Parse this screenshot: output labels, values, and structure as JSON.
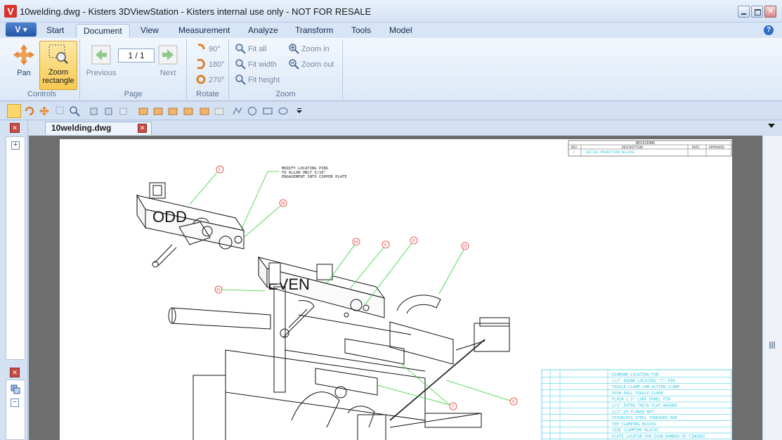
{
  "window": {
    "app_logo": "V",
    "title": "10welding.dwg - Kisters 3DViewStation - Kisters internal use only - NOT FOR RESALE"
  },
  "menu": {
    "app_button": "V",
    "tabs": [
      "Start",
      "Document",
      "View",
      "Measurement",
      "Analyze",
      "Transform",
      "Tools",
      "Model"
    ],
    "active_tab": "Document",
    "help": "?"
  },
  "ribbon": {
    "controls": {
      "label": "Controls",
      "pan": "Pan",
      "zoom_rect_line1": "Zoom",
      "zoom_rect_line2": "rectangle"
    },
    "page": {
      "label": "Page",
      "previous": "Previous",
      "next": "Next",
      "current": "1 / 1"
    },
    "rotate": {
      "label": "Rotate",
      "r90": "90°",
      "r180": "180°",
      "r270": "270°"
    },
    "zoom": {
      "label": "Zoom",
      "fit_all": "Fit all",
      "fit_width": "Fit width",
      "fit_height": "Fit height",
      "zoom_in": "Zoom in",
      "zoom_out": "Zoom out"
    }
  },
  "document": {
    "tab_name": "10welding.dwg"
  },
  "drawing": {
    "revisions_title": "REVISIONS",
    "rev_headers": [
      "REV",
      "DESCRIPTION",
      "DATE",
      "APPROVED"
    ],
    "rev_row": [
      "1",
      "INITIAL PRODUCTION RELEASE",
      "",
      ""
    ],
    "note": [
      "MODIFY LOCATING PINS",
      "TO ALLOW ONLY 5/16\"",
      "ENGAGEMENT INTO COPPER PLATE"
    ],
    "labels_odd": "ODD",
    "labels_even": "EVEN",
    "balloons": [
      "5",
      "16",
      "14",
      "6",
      "8",
      "13",
      "15",
      "9",
      "7"
    ],
    "bom_rows": [
      "DIAMOND LOCATING PIN",
      "1/2\" ROUND LOCATING \"T\" PIN",
      "TOGGLE CLAMP CAM ACTION CLAMP",
      "PUSH-PULL TOGGLE CLAMP",
      "PLAIN 1.5\" LONG DOWEL PIN",
      "1/2\" EXTRA THICK FLAT WASHER",
      "1/2\"-20 FLANGE NUT",
      "STAINLESS STEEL THREADED ROD",
      "TOP CLAMPING BLOCKS",
      "SIDE CLAMPING BLOCKS",
      "PLATE LOCATOR FOR EVEN NUMBER OF FINGERS"
    ]
  },
  "colors": {
    "accent_active": "#f8c952",
    "cad_green": "#2fd12f",
    "cad_red": "#e8332b",
    "cad_cyan": "#27c6e2",
    "viewport_bg": "#6e6e6e"
  }
}
